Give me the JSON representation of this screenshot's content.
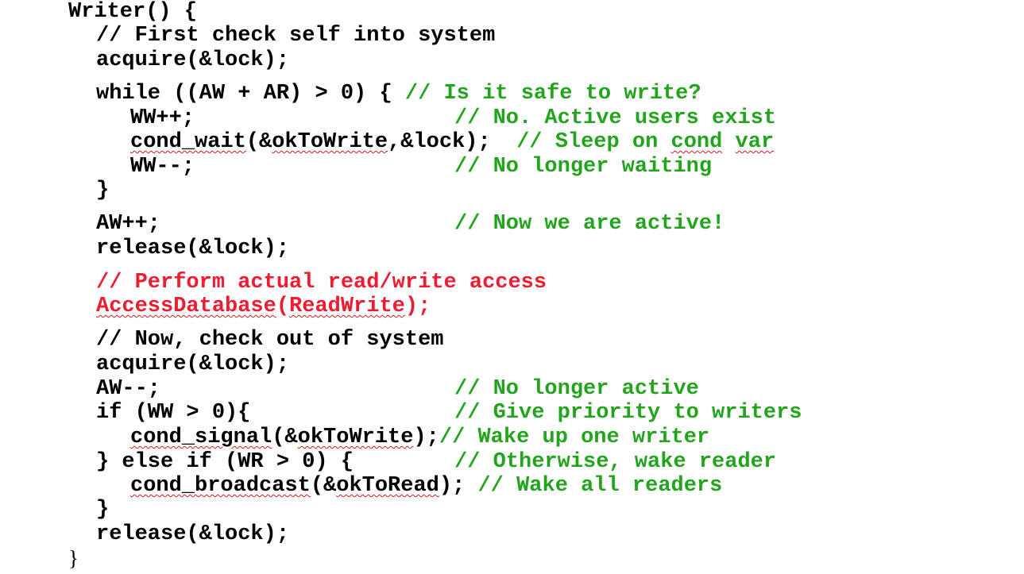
{
  "lines": [
    [
      {
        "text": "Writer() {",
        "color": "black"
      }
    ],
    [
      {
        "text": "// First check self into system",
        "color": "black"
      }
    ],
    [
      {
        "text": "acquire(&lock);",
        "color": "black"
      }
    ],
    [
      {
        "text": "while ((AW + AR) > 0) { ",
        "color": "black"
      },
      {
        "text": "// Is it safe to write?",
        "color": "green"
      }
    ],
    [
      {
        "text": "WW++;",
        "color": "black"
      },
      {
        "text": "// No. Active users exist",
        "color": "green"
      }
    ],
    [
      {
        "text": "cond_wait",
        "color": "black",
        "squiggle": true
      },
      {
        "text": "(&",
        "color": "black"
      },
      {
        "text": "okToWrite",
        "color": "black",
        "squiggle": true
      },
      {
        "text": ",&lock);",
        "color": "black"
      },
      {
        "text": "  // Sleep on ",
        "color": "green"
      },
      {
        "text": "cond",
        "color": "green",
        "squiggle": true
      },
      {
        "text": " ",
        "color": "green"
      },
      {
        "text": "var",
        "color": "green",
        "squiggle": true
      }
    ],
    [
      {
        "text": "WW--;",
        "color": "black"
      },
      {
        "text": "// No longer waiting",
        "color": "green"
      }
    ],
    [
      {
        "text": "}",
        "color": "black"
      }
    ],
    [
      {
        "text": "AW++;",
        "color": "black"
      },
      {
        "text": "// Now we are active!",
        "color": "green"
      }
    ],
    [
      {
        "text": "release(&lock);",
        "color": "black"
      }
    ],
    [
      {
        "text": "// Perform actual read/write access",
        "color": "red"
      }
    ],
    [
      {
        "text": "AccessDatabase",
        "color": "red",
        "squiggle": true
      },
      {
        "text": "(",
        "color": "red"
      },
      {
        "text": "ReadWrite",
        "color": "red",
        "squiggle": true
      },
      {
        "text": ");",
        "color": "red"
      }
    ],
    [
      {
        "text": "// Now, check out of system",
        "color": "black"
      }
    ],
    [
      {
        "text": "acquire(&lock);",
        "color": "black"
      }
    ],
    [
      {
        "text": "AW--;",
        "color": "black"
      },
      {
        "text": "// No longer active",
        "color": "green"
      }
    ],
    [
      {
        "text": "if (WW > 0){",
        "color": "black"
      },
      {
        "text": "// Give priority to writers",
        "color": "green"
      }
    ],
    [
      {
        "text": "cond_signal",
        "color": "black",
        "squiggle": true
      },
      {
        "text": "(&",
        "color": "black"
      },
      {
        "text": "okToWrite",
        "color": "black",
        "squiggle": true
      },
      {
        "text": ");",
        "color": "black"
      },
      {
        "text": "// Wake up one writer",
        "color": "green"
      }
    ],
    [
      {
        "text": "} else if (WR > 0) {",
        "color": "black"
      },
      {
        "text": "// Otherwise, wake reader",
        "color": "green"
      }
    ],
    [
      {
        "text": "cond_broadcast",
        "color": "black",
        "squiggle": true
      },
      {
        "text": "(&",
        "color": "black"
      },
      {
        "text": "okToRead",
        "color": "black",
        "squiggle": true
      },
      {
        "text": "); ",
        "color": "black"
      },
      {
        "text": "// Wake all readers",
        "color": "green"
      }
    ],
    [
      {
        "text": "}",
        "color": "black"
      }
    ],
    [
      {
        "text": "release(&lock);",
        "color": "black"
      }
    ]
  ],
  "closing_brace": "}",
  "colors": {
    "black": "#000000",
    "green": "#22a51c",
    "red": "#ee1c31"
  }
}
